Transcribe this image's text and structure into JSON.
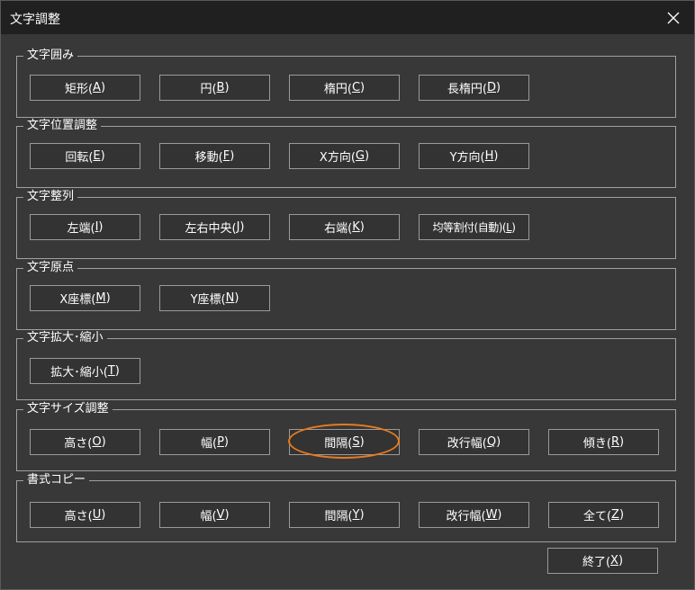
{
  "window": {
    "title": "文字調整",
    "close_icon": "close-icon"
  },
  "accent_color": "#e87a1e",
  "groups": [
    {
      "label": "文字囲み",
      "buttons": [
        {
          "text": "矩形(",
          "key": "A",
          "end": ")"
        },
        {
          "text": "円(",
          "key": "B",
          "end": ")"
        },
        {
          "text": "楕円(",
          "key": "C",
          "end": ")"
        },
        {
          "text": "長楕円(",
          "key": "D",
          "end": ")"
        }
      ]
    },
    {
      "label": "文字位置調整",
      "buttons": [
        {
          "text": "回転(",
          "key": "E",
          "end": ")"
        },
        {
          "text": "移動(",
          "key": "F",
          "end": ")"
        },
        {
          "text": "X方向(",
          "key": "G",
          "end": ")"
        },
        {
          "text": "Y方向(",
          "key": "H",
          "end": ")"
        }
      ]
    },
    {
      "label": "文字整列",
      "buttons": [
        {
          "text": "左端(",
          "key": "I",
          "end": ")"
        },
        {
          "text": "左右中央(",
          "key": "J",
          "end": ")"
        },
        {
          "text": "右端(",
          "key": "K",
          "end": ")"
        },
        {
          "text": "均等割付(自動)(",
          "key": "L",
          "end": ")"
        }
      ]
    },
    {
      "label": "文字原点",
      "buttons": [
        {
          "text": "X座標(",
          "key": "M",
          "end": ")"
        },
        {
          "text": "Y座標(",
          "key": "N",
          "end": ")"
        }
      ]
    },
    {
      "label": "文字拡大･縮小",
      "buttons": [
        {
          "text": "拡大･縮小(",
          "key": "T",
          "end": ")"
        }
      ]
    },
    {
      "label": "文字サイズ調整",
      "buttons": [
        {
          "text": "高さ(",
          "key": "O",
          "end": ")"
        },
        {
          "text": "幅(",
          "key": "P",
          "end": ")"
        },
        {
          "text": "間隔(",
          "key": "S",
          "end": ")"
        },
        {
          "text": "改行幅(",
          "key": "Q",
          "end": ")"
        },
        {
          "text": "傾き(",
          "key": "R",
          "end": ")"
        }
      ]
    },
    {
      "label": "書式コピー",
      "buttons": [
        {
          "text": "高さ(",
          "key": "U",
          "end": ")"
        },
        {
          "text": "幅(",
          "key": "V",
          "end": ")"
        },
        {
          "text": "間隔(",
          "key": "Y",
          "end": ")"
        },
        {
          "text": "改行幅(",
          "key": "W",
          "end": ")"
        },
        {
          "text": "全て(",
          "key": "Z",
          "end": ")"
        }
      ]
    }
  ],
  "footer": {
    "close_button": {
      "text": "終了(",
      "key": "X",
      "end": ")"
    }
  }
}
